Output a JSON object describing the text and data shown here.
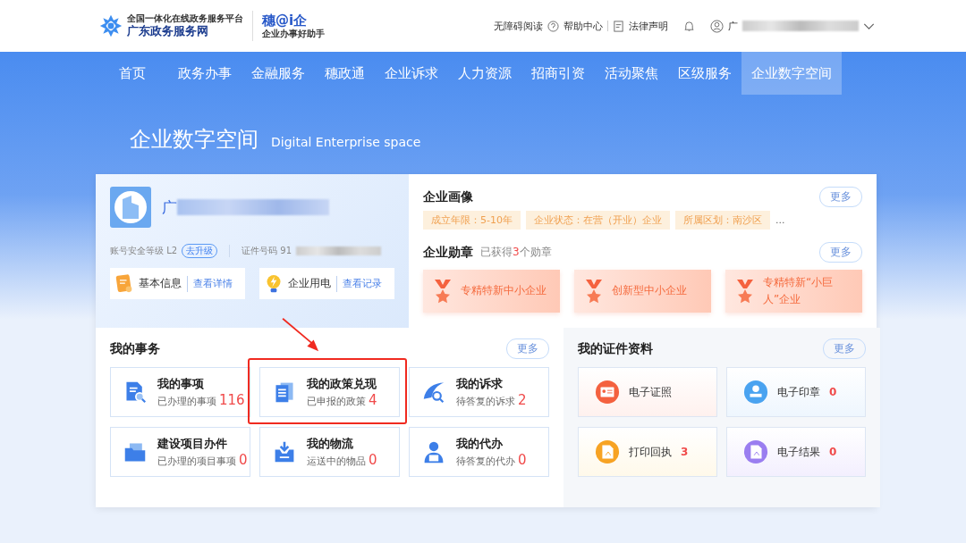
{
  "header": {
    "logo_small": "全国一体化在线政务服务平台",
    "logo_title": "广东政务服务网",
    "brand": "穗@i企",
    "brand_sub": "企业办事好助手",
    "links": [
      "无障碍阅读",
      "帮助中心",
      "法律声明"
    ],
    "user": "广"
  },
  "nav": [
    {
      "label": "首页",
      "selected": false
    },
    {
      "label": "政务办事",
      "selected": false
    },
    {
      "label": "金融服务",
      "selected": false
    },
    {
      "label": "穗政通",
      "selected": false
    },
    {
      "label": "企业诉求",
      "selected": false
    },
    {
      "label": "人力资源",
      "selected": false
    },
    {
      "label": "招商引资",
      "selected": false
    },
    {
      "label": "活动聚焦",
      "selected": false
    },
    {
      "label": "区级服务",
      "selected": false
    },
    {
      "label": "企业数字空间",
      "selected": true
    }
  ],
  "hero": {
    "title": "企业数字空间",
    "subtitle": "Digital Enterprise space"
  },
  "company": {
    "name": "广",
    "security_label": "账号安全等级 L2",
    "upgrade": "去升级",
    "cert_label": "证件号码 91",
    "actions": [
      {
        "kind": "info",
        "label": "基本信息",
        "link": "查看详情"
      },
      {
        "kind": "power",
        "label": "企业用电",
        "link": "查看记录"
      }
    ]
  },
  "portrait": {
    "title": "企业画像",
    "more": "更多",
    "tags": [
      "成立年限：5-10年",
      "企业状态：在营（开业）企业",
      "所属区划：南沙区"
    ],
    "ellipsis": "..."
  },
  "medals": {
    "title": "企业勋章",
    "count_prefix": "已获得",
    "count": "3",
    "count_suffix": "个勋章",
    "more": "更多",
    "items": [
      "专精特新中小企业",
      "创新型中小企业",
      "专精特新“小巨人”企业"
    ]
  },
  "affairs": {
    "title": "我的事务",
    "more": "更多",
    "items": [
      {
        "kind": "matters",
        "title": "我的事项",
        "desc": "已办理的事项",
        "count": "116",
        "highlighted": false
      },
      {
        "kind": "policy",
        "title": "我的政策兑现",
        "desc": "已申报的政策",
        "count": "4",
        "highlighted": true
      },
      {
        "kind": "appeal",
        "title": "我的诉求",
        "desc": "待答复的诉求",
        "count": "2",
        "highlighted": false
      },
      {
        "kind": "project",
        "title": "建设项目办件",
        "desc": "已办理的项目事项",
        "count": "0",
        "highlighted": false
      },
      {
        "kind": "logistics",
        "title": "我的物流",
        "desc": "运送中的物品",
        "count": "0",
        "highlighted": false
      },
      {
        "kind": "agent",
        "title": "我的代办",
        "desc": "待答复的代办",
        "count": "0",
        "highlighted": false
      }
    ]
  },
  "certificates": {
    "title": "我的证件资料",
    "more": "更多",
    "items": [
      {
        "kind": "license",
        "label": "电子证照",
        "color": "#f4613f"
      },
      {
        "kind": "seal",
        "label": "电子印章",
        "count": "0",
        "color": "#4aa3f0"
      },
      {
        "kind": "receipt",
        "label": "打印回执",
        "count": "3",
        "color": "#f7a324"
      },
      {
        "kind": "result",
        "label": "电子结果",
        "count": "0",
        "color": "#9a7ef0"
      }
    ]
  }
}
